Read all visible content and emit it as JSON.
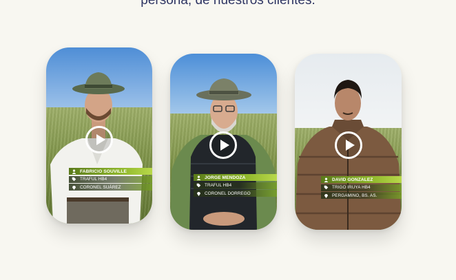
{
  "headline": "persona, de nuestros clientes.",
  "videos": [
    {
      "name": "FABRICIO SOUVILLE",
      "product": "TRAFUL HB4",
      "location": "CORONEL SUÁREZ",
      "play_icon": "play-circle-icon"
    },
    {
      "name": "JORGE MENDOZA",
      "product": "TRAFUL HB4",
      "location": "CORONEL DORREGO",
      "play_icon": "play-circle-icon"
    },
    {
      "name": "DAVID GONZALEZ",
      "product": "TRIGO IRUYA HB4",
      "location": "PERGAMINO, BS. AS.",
      "play_icon": "play-circle-icon"
    }
  ],
  "colors": {
    "background": "#f8f7f1",
    "headline": "#2e3563",
    "caption_green": "#8db52a"
  }
}
